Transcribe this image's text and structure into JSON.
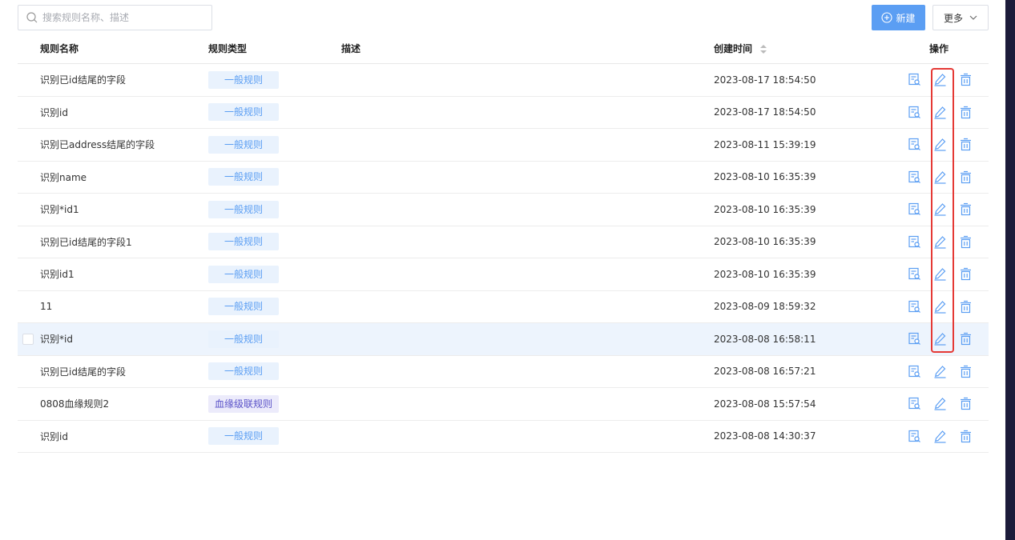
{
  "toolbar": {
    "search_placeholder": "搜索规则名称、描述",
    "new_label": "新建",
    "more_label": "更多"
  },
  "table": {
    "headers": {
      "name": "规则名称",
      "type": "规则类型",
      "desc": "描述",
      "time": "创建时间",
      "ops": "操作"
    },
    "rows": [
      {
        "name": "识别已id结尾的字段",
        "type": "一般规则",
        "desc": "",
        "time": "2023-08-17 18:54:50"
      },
      {
        "name": "识别id",
        "type": "一般规则",
        "desc": "",
        "time": "2023-08-17 18:54:50"
      },
      {
        "name": "识别已address结尾的字段",
        "type": "一般规则",
        "desc": "",
        "time": "2023-08-11 15:39:19"
      },
      {
        "name": "识别name",
        "type": "一般规则",
        "desc": "",
        "time": "2023-08-10 16:35:39"
      },
      {
        "name": "识别*id1",
        "type": "一般规则",
        "desc": "",
        "time": "2023-08-10 16:35:39"
      },
      {
        "name": "识别已id结尾的字段1",
        "type": "一般规则",
        "desc": "",
        "time": "2023-08-10 16:35:39"
      },
      {
        "name": "识别id1",
        "type": "一般规则",
        "desc": "",
        "time": "2023-08-10 16:35:39"
      },
      {
        "name": "11",
        "type": "一般规则",
        "desc": "",
        "time": "2023-08-09 18:59:32"
      },
      {
        "name": "识别*id",
        "type": "一般规则",
        "desc": "",
        "time": "2023-08-08 16:58:11"
      },
      {
        "name": "识别已id结尾的字段",
        "type": "一般规则",
        "desc": "",
        "time": "2023-08-08 16:57:21"
      },
      {
        "name": "0808血缘规则2",
        "type": "血缘级联规则",
        "desc": "",
        "time": "2023-08-08 15:57:54"
      },
      {
        "name": "识别id",
        "type": "一般规则",
        "desc": "",
        "time": "2023-08-08 14:30:37"
      }
    ],
    "hovered_row": 8
  },
  "icons": [
    "search-icon",
    "plus-circle-icon",
    "chevron-down-icon",
    "sort-icon",
    "view-detail-icon",
    "edit-icon",
    "delete-icon"
  ],
  "colors": {
    "accent": "#5b9ef3",
    "tag_bg": "#e9f2fd",
    "lineage_tag": "#5a52c8",
    "highlight": "#e53935",
    "hover_row": "#edf4fd"
  }
}
